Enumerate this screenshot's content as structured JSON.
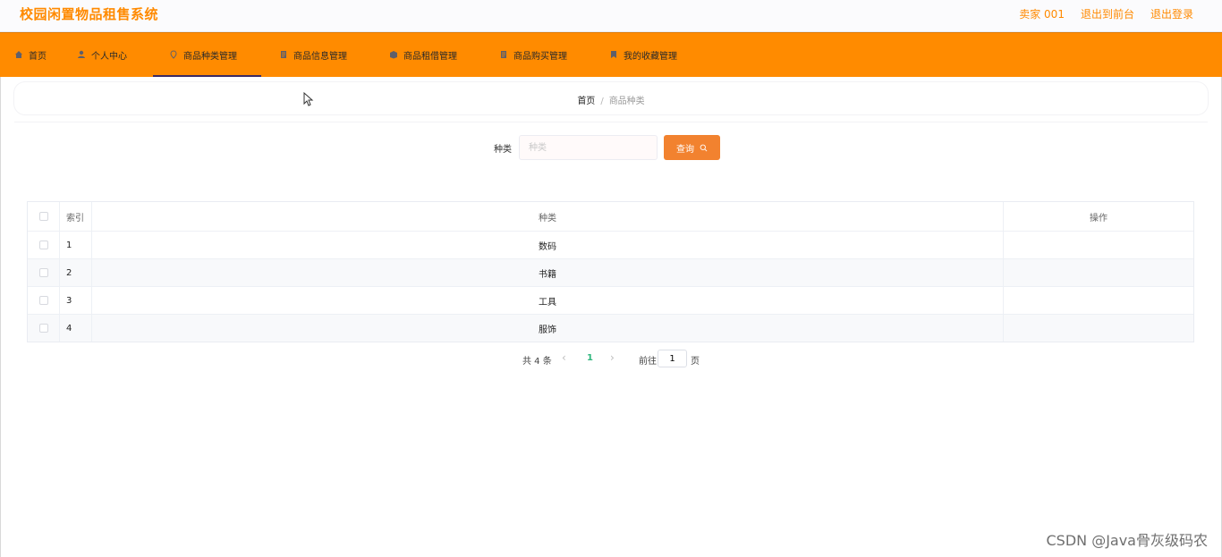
{
  "header": {
    "title": "校园闲置物品租售系统",
    "user_label": "卖家 001",
    "front_label": "退出到前台",
    "logout_label": "退出登录"
  },
  "nav": {
    "items": [
      {
        "label": "首页",
        "icon": "home-icon"
      },
      {
        "label": "个人中心",
        "icon": "user-icon"
      },
      {
        "label": "商品种类管理",
        "icon": "tag-icon"
      },
      {
        "label": "商品信息管理",
        "icon": "document-icon"
      },
      {
        "label": "商品租借管理",
        "icon": "box-icon"
      },
      {
        "label": "商品购买管理",
        "icon": "document-icon"
      },
      {
        "label": "我的收藏管理",
        "icon": "bookmark-icon"
      }
    ]
  },
  "breadcrumb": {
    "home": "首页",
    "current": "商品种类",
    "separator": "/"
  },
  "search": {
    "label": "种类",
    "placeholder": "种类",
    "button_label": "查询",
    "icon": "search-icon"
  },
  "table": {
    "headers": [
      "索引",
      "种类",
      "操作"
    ],
    "rows": [
      {
        "index": "1",
        "kind": "数码"
      },
      {
        "index": "2",
        "kind": "书籍"
      },
      {
        "index": "3",
        "kind": "工具"
      },
      {
        "index": "4",
        "kind": "服饰"
      }
    ]
  },
  "pagination": {
    "total": "共 4 条",
    "current": "1",
    "goto_label": "前往",
    "goto_value": "1",
    "page_label": "页"
  },
  "watermark": "CSDN @Java骨灰级码农",
  "colors": {
    "brand": "#ff8a00",
    "nav": "#ff8b00",
    "button": "#f2822f",
    "active_page": "#2eb67d"
  }
}
